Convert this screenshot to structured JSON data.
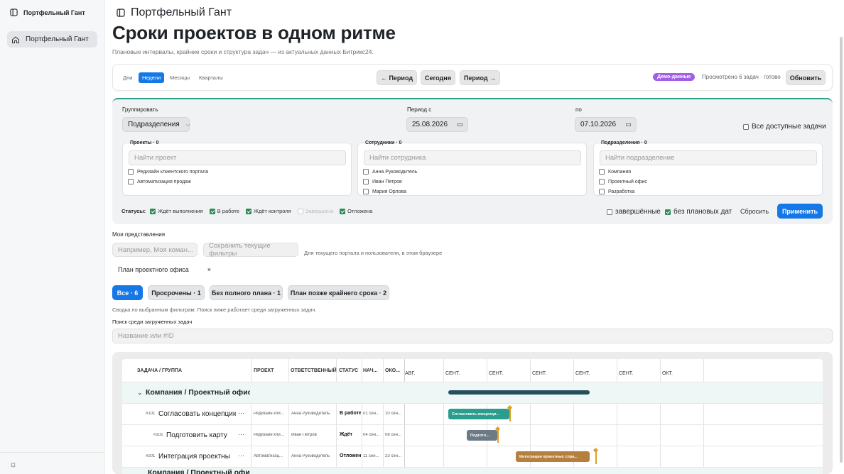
{
  "sidebar": {
    "app_title": "Портфельный Гант",
    "items": [
      {
        "label": "Портфельный Гант",
        "icon": "home-icon"
      }
    ],
    "footer_icon": "settings-sun-icon"
  },
  "header": {
    "title": "Портфельный Гант",
    "heading": "Сроки проектов в одном ритме",
    "subtitle": "Плановые интервалы, крайние сроки и структура задач — из актуальных данных Битрикс24."
  },
  "toolbar": {
    "scales": [
      "Дни",
      "Недели",
      "Месяцы",
      "Кварталы"
    ],
    "active_scale": "Недели",
    "prev_label": "← Период",
    "today_label": "Сегодня",
    "next_label": "Период →",
    "demo_badge": "Демо-данные",
    "viewed_text": "Просмотрено 6 задач · готово",
    "refresh_label": "Обновить"
  },
  "filters": {
    "group_label": "Группировать",
    "group_value": "Подразделения",
    "period_from_label": "Период с",
    "period_from": "25.08.2026",
    "period_to_label": "по",
    "period_to": "07.10.2026",
    "all_tasks_label": "Все доступные задачи",
    "projects": {
      "title": "Проекты · 0",
      "placeholder": "Найти проект",
      "items": [
        "Редизайн клиентского портала",
        "Автоматизация продаж"
      ]
    },
    "employees": {
      "title": "Сотрудники · 0",
      "placeholder": "Найти сотрудника",
      "items": [
        "Анна Руководитель",
        "Иван Петров",
        "Мария Орлова"
      ]
    },
    "departments": {
      "title": "Подразделения · 0",
      "placeholder": "Найти подразделение",
      "items": [
        "Компания",
        "Проектный офис",
        "Разработка"
      ]
    },
    "statuses_label": "Статусы:",
    "statuses": [
      {
        "label": "Ждёт выполнения",
        "checked": true
      },
      {
        "label": "В работе",
        "checked": true
      },
      {
        "label": "Ждёт контроля",
        "checked": true
      },
      {
        "label": "Завершена",
        "checked": false
      },
      {
        "label": "Отложена",
        "checked": true
      }
    ],
    "completed_label": "завершённые",
    "completed_checked": false,
    "no_dates_label": "без плановых дат",
    "no_dates_checked": true,
    "reset_label": "Сбросить",
    "apply_label": "Применить"
  },
  "views": {
    "label": "Мои представления",
    "name_placeholder": "Например, Моя коман...",
    "save_label": "Сохранить текущие фильтры",
    "hint": "Для текущего портала и пользователя, в этом браузере",
    "saved": [
      {
        "name": "План проектного офиса",
        "remove": "×"
      }
    ]
  },
  "summary": {
    "chips": [
      {
        "label": "Все · 6",
        "active": true
      },
      {
        "label": "Просрочены · 1",
        "active": false
      },
      {
        "label": "Без полного плана · 1",
        "active": false
      },
      {
        "label": "План позже крайнего срока · 2",
        "active": false
      }
    ],
    "note": "Сводка по выбранным фильтрам. Поиск ниже работает среди загруженных задач.",
    "search_label": "Поиск среди загруженных задач",
    "search_placeholder": "Название или #ID"
  },
  "gantt": {
    "columns": [
      "ЗАДАЧА / ГРУППА",
      "ПРОЕКТ",
      "ОТВЕТСТВЕННЫЙ",
      "СТАТУС",
      "НАЧ...",
      "ОКО..."
    ],
    "timeline_headers": [
      "АВГ.",
      "СЕНТ.",
      "СЕНТ.",
      "СЕНТ.",
      "СЕНТ.",
      "СЕНТ.",
      "ОКТ."
    ],
    "groups": [
      {
        "name": "Компания / Проектный офис",
        "toggle": "⌄",
        "rows": [
          {
            "id": "#101",
            "name": "Согласовать концепцию",
            "more": "···",
            "project": "Редизайн кли...",
            "owner": "Анна Руководитель",
            "status": "В работе",
            "start": "01 сен...",
            "end": "10 сен...",
            "bar_label": "Согласовать концепци...",
            "bar_color": "#2a9d8f"
          },
          {
            "id": "#102",
            "name": "Подготовить карту",
            "more": "···",
            "project": "Редизайн кли...",
            "owner": "Иван Петров",
            "status": "Ждёт",
            "start": "04 сен...",
            "end": "08 сен...",
            "bar_label": "Подгото...",
            "bar_color": "#6c7a86"
          },
          {
            "id": "#201",
            "name": "Интеграция проектных справочников",
            "more": "···",
            "project": "Автоматизац...",
            "owner": "Анна Руководитель",
            "status": "Отложена",
            "start": "11 сен...",
            "end": "23 сен...",
            "bar_label": "Интеграция проектных спра...",
            "bar_color": "#b5803d"
          }
        ]
      },
      {
        "name": "Компания / Проектный офис",
        "toggle": "⌄",
        "rows": []
      }
    ]
  }
}
